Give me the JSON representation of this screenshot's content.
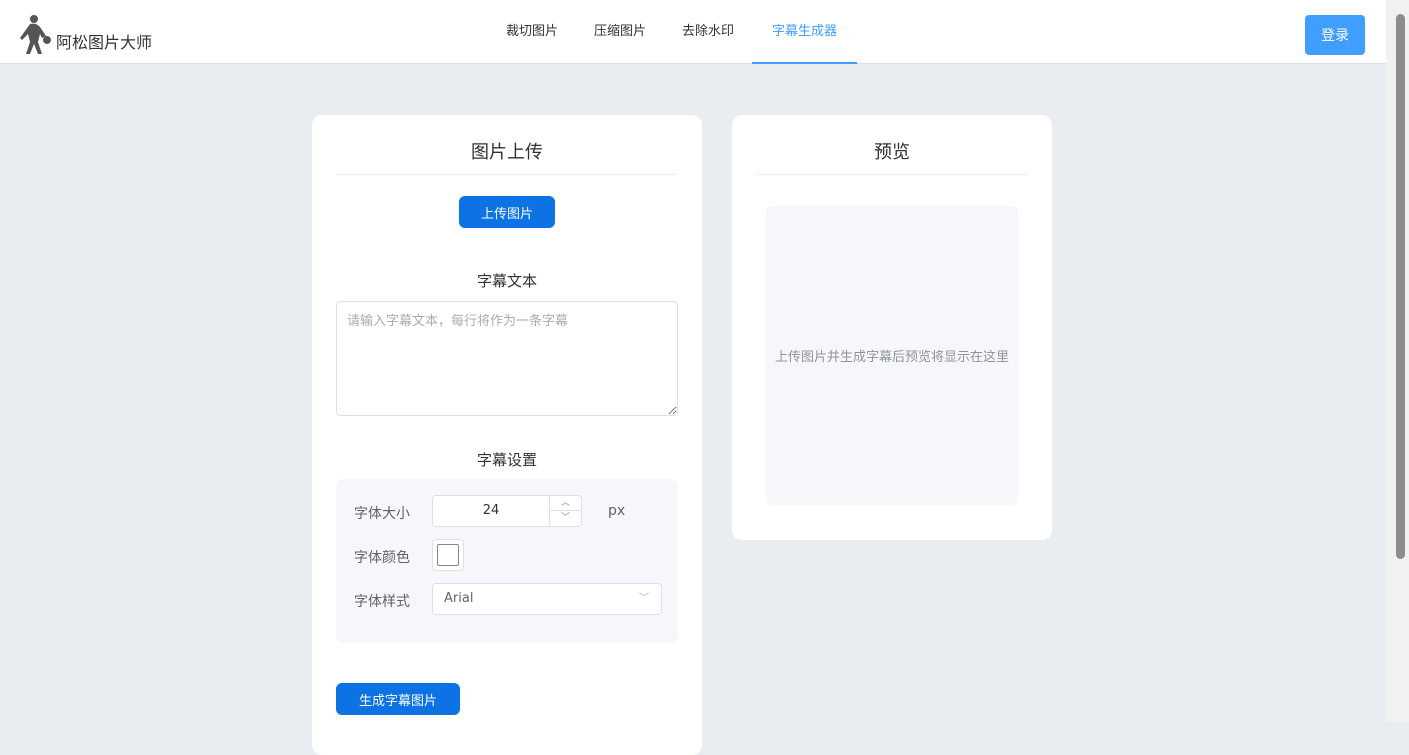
{
  "app": {
    "title": "阿松图片大师"
  },
  "nav": [
    "裁切图片",
    "压缩图片",
    "去除水印",
    "字幕生成器"
  ],
  "login": "登录",
  "upload": {
    "title": "图片上传",
    "button": "上传图片",
    "text_title": "字幕文本",
    "placeholder": "请输入字幕文本，每行将作为一条字幕",
    "settings_title": "字幕设置",
    "font_size_label": "字体大小",
    "font_size": "24",
    "unit": "px",
    "font_color_label": "字体颜色",
    "font_color": "#ffffff",
    "font_style_label": "字体样式",
    "font_style": "Arial",
    "generate": "生成字幕图片"
  },
  "preview": {
    "title": "预览",
    "placeholder": "上传图片并生成字幕后预览将显示在这里"
  }
}
